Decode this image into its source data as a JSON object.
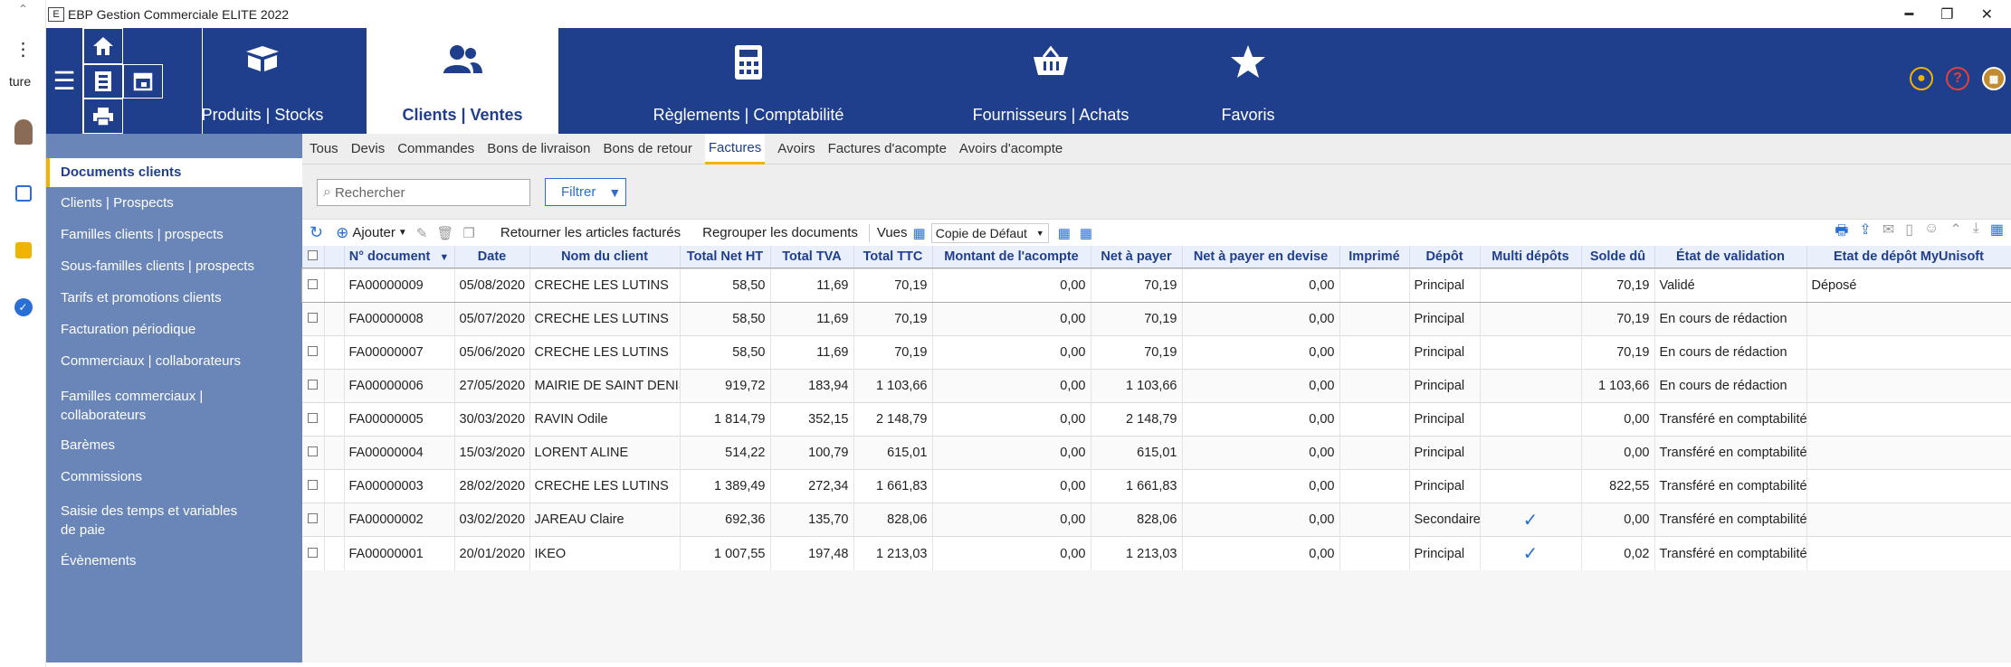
{
  "window": {
    "title": "EBP Gestion Commerciale ELITE 2022",
    "app_icon": "E"
  },
  "left_strip": {
    "dots": "⋮",
    "label": "ture"
  },
  "topbar": {
    "tabs": [
      {
        "label": "Produits | Stocks",
        "icon": "box-icon"
      },
      {
        "label": "Clients | Ventes",
        "icon": "users-icon"
      },
      {
        "label": "Règlements | Comptabilité",
        "icon": "calculator-icon"
      },
      {
        "label": "Fournisseurs | Achats",
        "icon": "basket-icon"
      },
      {
        "label": "Favoris",
        "icon": "star-icon"
      }
    ],
    "accent": "#1f3f8d"
  },
  "sidebar": {
    "items": [
      "Documents clients",
      "Clients | Prospects",
      "Familles clients | prospects",
      "Sous-familles clients | prospects",
      "Tarifs et promotions clients",
      "Facturation périodique",
      "Commerciaux | collaborateurs",
      "Familles commerciaux | collaborateurs",
      "Barèmes",
      "Commissions",
      "Saisie des temps et variables de paie",
      "Évènements"
    ]
  },
  "subtabs": [
    "Tous",
    "Devis",
    "Commandes",
    "Bons de livraison",
    "Bons de retour",
    "Factures",
    "Avoirs",
    "Factures d'acompte",
    "Avoirs d'acompte"
  ],
  "search": {
    "placeholder": "Rechercher"
  },
  "filter_label": "Filtrer",
  "toolbar": {
    "add": "Ajouter",
    "return_items": "Retourner les articles facturés",
    "group_docs": "Regrouper les documents",
    "views_label": "Vues",
    "view_value": "Copie de Défaut"
  },
  "table": {
    "columns": [
      "N° document",
      "Date",
      "Nom du client",
      "Total Net HT",
      "Total TVA",
      "Total TTC",
      "Montant de l'acompte",
      "Net à payer",
      "Net à payer en devise",
      "Imprimé",
      "Dépôt",
      "Multi dépôts",
      "Solde dû",
      "État de validation",
      "Etat de dépôt MyUnisoft"
    ],
    "rows": [
      {
        "doc": "FA00000009",
        "date": "05/08/2020",
        "client": "CRECHE LES LUTINS",
        "ht": "58,50",
        "tva": "11,69",
        "ttc": "70,19",
        "acompte": "0,00",
        "net": "70,19",
        "devise": "0,00",
        "depot": "Principal",
        "multi": false,
        "solde": "70,19",
        "etat": "Validé",
        "myunisoft": "Déposé"
      },
      {
        "doc": "FA00000008",
        "date": "05/07/2020",
        "client": "CRECHE LES LUTINS",
        "ht": "58,50",
        "tva": "11,69",
        "ttc": "70,19",
        "acompte": "0,00",
        "net": "70,19",
        "devise": "0,00",
        "depot": "Principal",
        "multi": false,
        "solde": "70,19",
        "etat": "En cours de rédaction",
        "myunisoft": ""
      },
      {
        "doc": "FA00000007",
        "date": "05/06/2020",
        "client": "CRECHE LES LUTINS",
        "ht": "58,50",
        "tva": "11,69",
        "ttc": "70,19",
        "acompte": "0,00",
        "net": "70,19",
        "devise": "0,00",
        "depot": "Principal",
        "multi": false,
        "solde": "70,19",
        "etat": "En cours de rédaction",
        "myunisoft": ""
      },
      {
        "doc": "FA00000006",
        "date": "27/05/2020",
        "client": "MAIRIE DE SAINT DENIS",
        "ht": "919,72",
        "tva": "183,94",
        "ttc": "1 103,66",
        "acompte": "0,00",
        "net": "1 103,66",
        "devise": "0,00",
        "depot": "Principal",
        "multi": false,
        "solde": "1 103,66",
        "etat": "En cours de rédaction",
        "myunisoft": ""
      },
      {
        "doc": "FA00000005",
        "date": "30/03/2020",
        "client": "RAVIN Odile",
        "ht": "1 814,79",
        "tva": "352,15",
        "ttc": "2 148,79",
        "acompte": "0,00",
        "net": "2 148,79",
        "devise": "0,00",
        "depot": "Principal",
        "multi": false,
        "solde": "0,00",
        "etat": "Transféré en comptabilité",
        "myunisoft": ""
      },
      {
        "doc": "FA00000004",
        "date": "15/03/2020",
        "client": "LORENT ALINE",
        "ht": "514,22",
        "tva": "100,79",
        "ttc": "615,01",
        "acompte": "0,00",
        "net": "615,01",
        "devise": "0,00",
        "depot": "Principal",
        "multi": false,
        "solde": "0,00",
        "etat": "Transféré en comptabilité",
        "myunisoft": ""
      },
      {
        "doc": "FA00000003",
        "date": "28/02/2020",
        "client": "CRECHE LES LUTINS",
        "ht": "1 389,49",
        "tva": "272,34",
        "ttc": "1 661,83",
        "acompte": "0,00",
        "net": "1 661,83",
        "devise": "0,00",
        "depot": "Principal",
        "multi": false,
        "solde": "822,55",
        "etat": "Transféré en comptabilité",
        "myunisoft": ""
      },
      {
        "doc": "FA00000002",
        "date": "03/02/2020",
        "client": "JAREAU Claire",
        "ht": "692,36",
        "tva": "135,70",
        "ttc": "828,06",
        "acompte": "0,00",
        "net": "828,06",
        "devise": "0,00",
        "depot": "Secondaire",
        "multi": true,
        "solde": "0,00",
        "etat": "Transféré en comptabilité",
        "myunisoft": ""
      },
      {
        "doc": "FA00000001",
        "date": "20/01/2020",
        "client": "IKEO",
        "ht": "1 007,55",
        "tva": "197,48",
        "ttc": "1 213,03",
        "acompte": "0,00",
        "net": "1 213,03",
        "devise": "0,00",
        "depot": "Principal",
        "multi": true,
        "solde": "0,02",
        "etat": "Transféré en comptabilité",
        "myunisoft": ""
      }
    ]
  }
}
